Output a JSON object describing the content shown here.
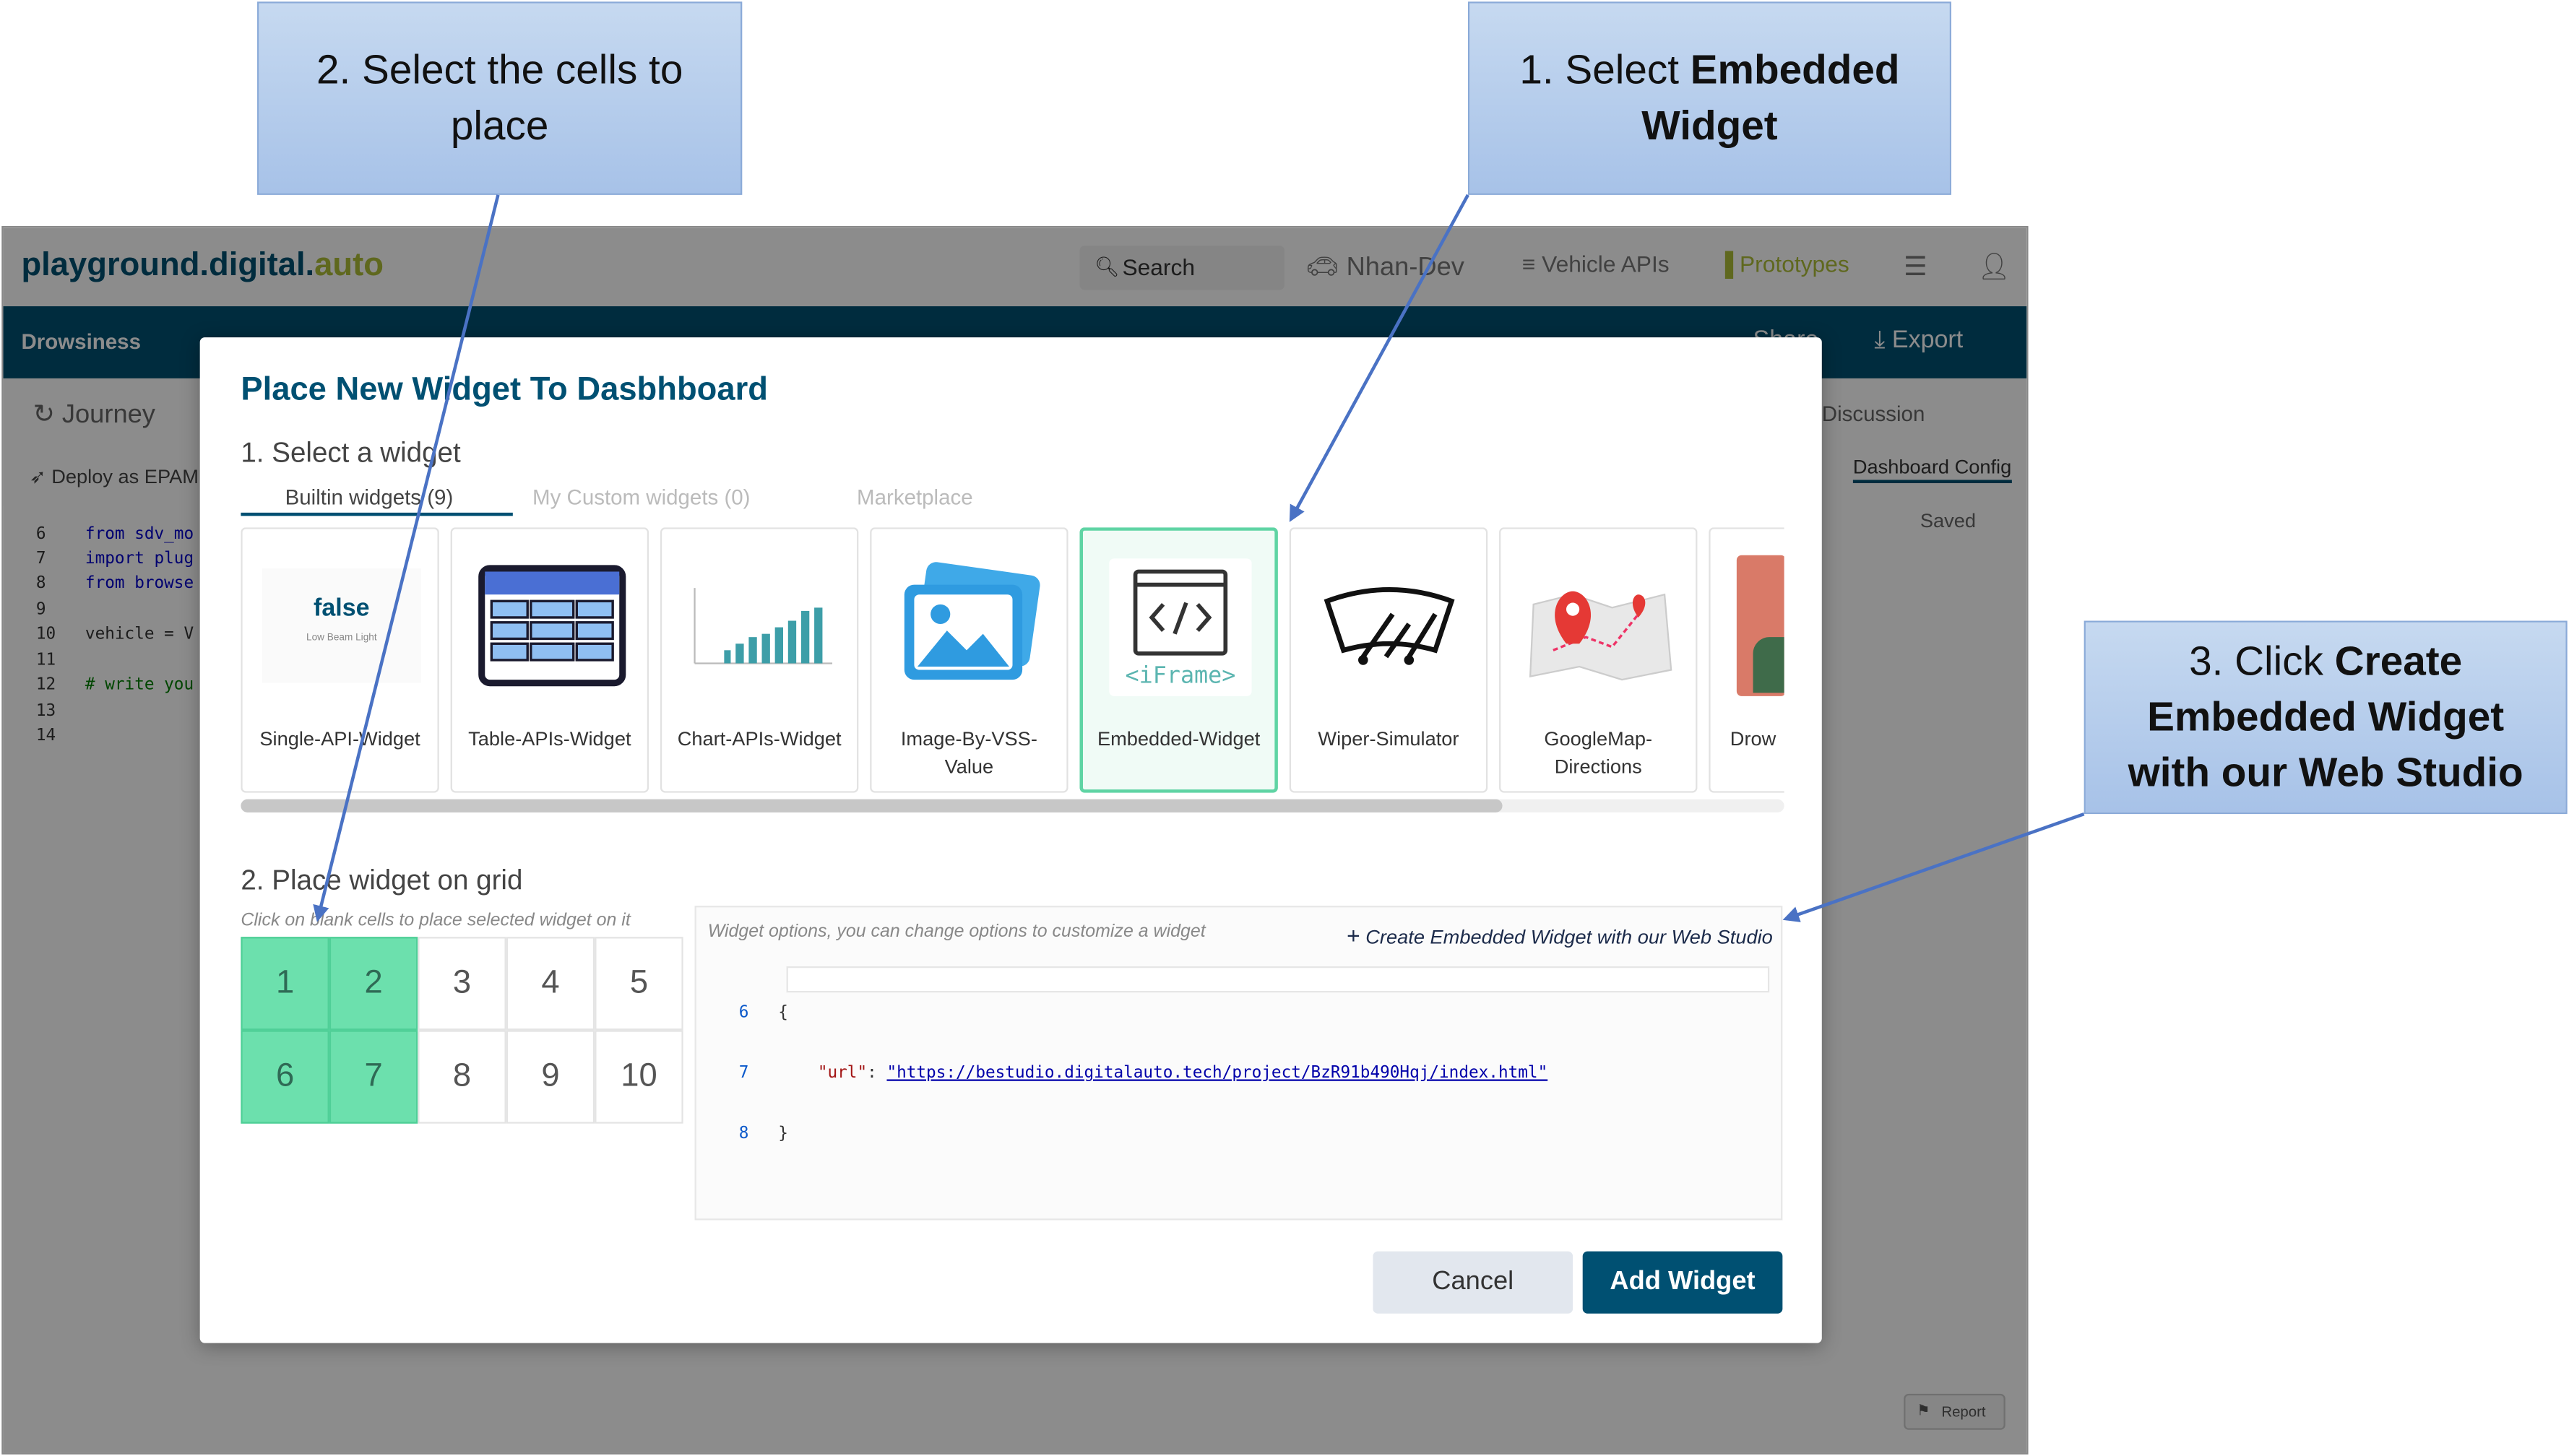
{
  "app": {
    "logo_prefix": "playground.digital.",
    "logo_suffix": "auto",
    "search_label": "Search",
    "nav_user": "Nhan-Dev",
    "nav_vehicle_apis": "Vehicle APIs",
    "nav_prototypes": "Prototypes",
    "prototype_title": "Drowsiness",
    "share_label": "Share",
    "export_label": "Export",
    "journey_tab": "Journey",
    "deploy_label": "Deploy as EPAM",
    "discussion_tab": "Discussion",
    "dashboard_config_tab": "Dashboard Config",
    "saved_label": "Saved",
    "report_label": "Report",
    "code_lines": [
      {
        "num": "6",
        "text": "from sdv_mo"
      },
      {
        "num": "7",
        "text": "import plug"
      },
      {
        "num": "8",
        "text": "from browse"
      },
      {
        "num": "9",
        "text": ""
      },
      {
        "num": "10",
        "text": "vehicle = V"
      },
      {
        "num": "11",
        "text": ""
      },
      {
        "num": "12",
        "text": "# write you"
      },
      {
        "num": "13",
        "text": ""
      },
      {
        "num": "14",
        "text": ""
      }
    ]
  },
  "modal": {
    "title": "Place New Widget To Dasbhboard",
    "section1_title": "1. Select a widget",
    "tabs": [
      {
        "label": "Builtin widgets (9)",
        "active": true
      },
      {
        "label": "My Custom widgets (0)",
        "active": false
      },
      {
        "label": "Marketplace",
        "active": false
      }
    ],
    "widgets": [
      {
        "label": "Single-API-Widget",
        "icon": "single-api-thumb",
        "thumb_value": "false",
        "thumb_caption": "Low Beam Light",
        "selected": false
      },
      {
        "label": "Table-APIs-Widget",
        "icon": "table-icon",
        "selected": false
      },
      {
        "label": "Chart-APIs-Widget",
        "icon": "bar-chart-thumb",
        "selected": false
      },
      {
        "label": "Image-By-VSS-Value",
        "icon": "image-icon",
        "selected": false
      },
      {
        "label": "Embedded-Widget",
        "icon": "iframe-icon",
        "thumb_text": "<iFrame>",
        "selected": true
      },
      {
        "label": "Wiper-Simulator",
        "icon": "wiper-icon",
        "selected": false
      },
      {
        "label": "GoogleMap-Directions",
        "icon": "map-icon",
        "selected": false
      },
      {
        "label": "Drow",
        "icon": "drowsiness-thumb",
        "selected": false
      }
    ],
    "section2_title": "2. Place widget on grid",
    "grid_hint": "Click on blank cells to place selected widget on it",
    "grid_cells": [
      {
        "label": "1",
        "filled": true
      },
      {
        "label": "2",
        "filled": true
      },
      {
        "label": "3",
        "filled": false
      },
      {
        "label": "4",
        "filled": false
      },
      {
        "label": "5",
        "filled": false
      },
      {
        "label": "6",
        "filled": true
      },
      {
        "label": "7",
        "filled": true
      },
      {
        "label": "8",
        "filled": false
      },
      {
        "label": "9",
        "filled": false
      },
      {
        "label": "10",
        "filled": false
      }
    ],
    "options_hint": "Widget options, you can change options to customize a widget",
    "create_link": "Create Embedded Widget with our Web Studio",
    "json_lines": [
      {
        "num": "6",
        "text": "{"
      },
      {
        "num": "7",
        "key": "\"url\"",
        "sep": ": ",
        "value": "\"https://bestudio.digitalauto.tech/project/BzR91b490Hqj/index.html\""
      },
      {
        "num": "8",
        "text": "}"
      }
    ],
    "cancel_label": "Cancel",
    "add_label": "Add Widget"
  },
  "callouts": {
    "step1_plain": "1. Select ",
    "step1_bold": "Embedded Widget",
    "step2": "2. Select the cells to place",
    "step3_plain": "3. Click ",
    "step3_bold": "Create Embedded Widget with our Web Studio"
  },
  "colors": {
    "brand": "#005072",
    "accent": "#aebd38",
    "grid_filled": "#6ce0ad",
    "selected_card": "#5fd4a4",
    "callout": "#a7c2e8",
    "arrow": "#4a72c4"
  }
}
